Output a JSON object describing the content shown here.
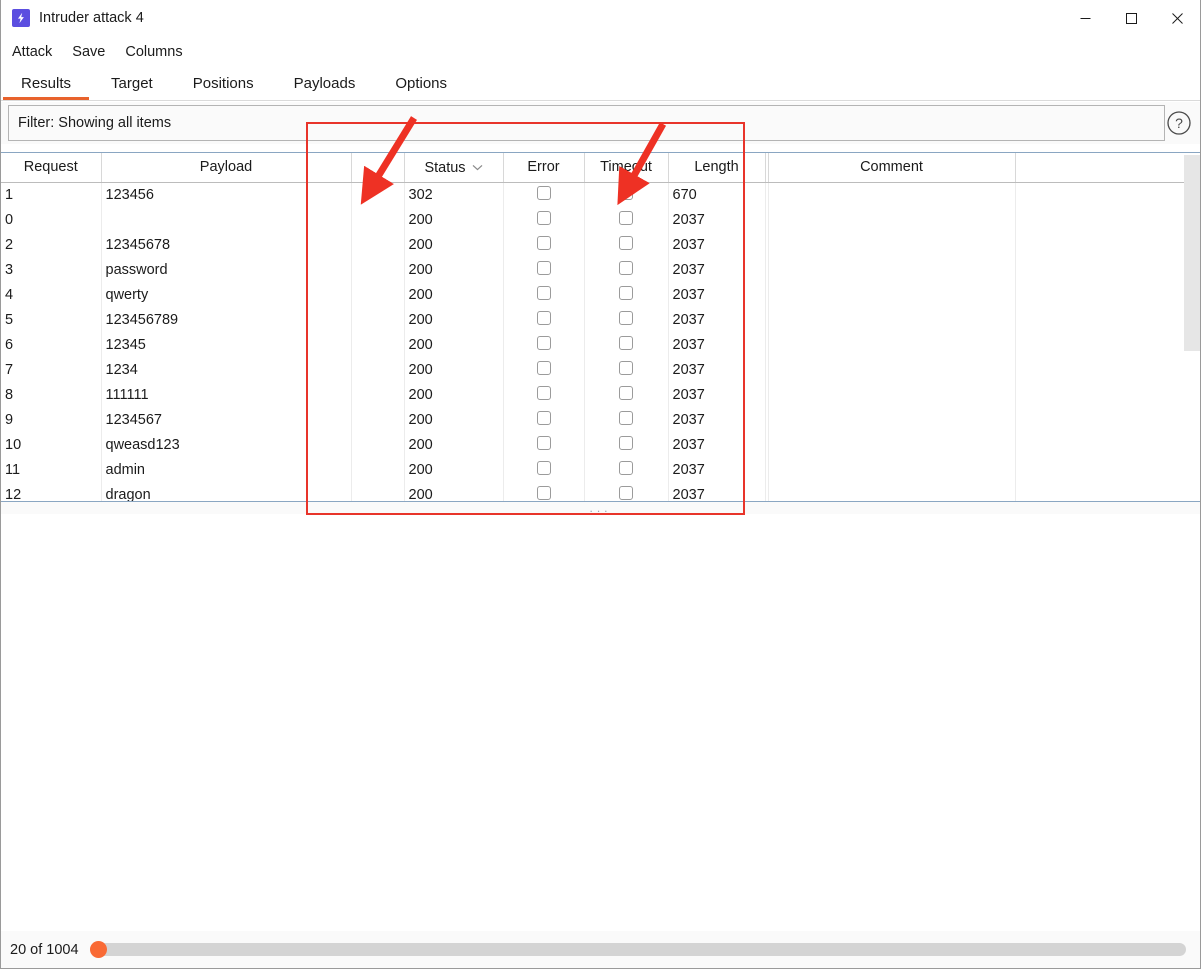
{
  "window": {
    "title": "Intruder attack 4",
    "icon": "lightning-bolt-icon",
    "controls": {
      "minimize": "minimize-icon",
      "maximize": "maximize-icon",
      "close": "close-icon"
    }
  },
  "menubar": {
    "items": [
      {
        "label": "Attack"
      },
      {
        "label": "Save"
      },
      {
        "label": "Columns"
      }
    ]
  },
  "tabs": [
    {
      "label": "Results",
      "active": true
    },
    {
      "label": "Target",
      "active": false
    },
    {
      "label": "Positions",
      "active": false
    },
    {
      "label": "Payloads",
      "active": false
    },
    {
      "label": "Options",
      "active": false
    }
  ],
  "filter": {
    "text": "Filter: Showing all items",
    "help_icon": "question-mark-circle-icon"
  },
  "table": {
    "columns": [
      {
        "key": "request",
        "label": "Request",
        "align": "left"
      },
      {
        "key": "payload",
        "label": "Payload",
        "align": "center"
      },
      {
        "key": "spacer1",
        "label": "",
        "align": "center"
      },
      {
        "key": "status",
        "label": "Status",
        "align": "center",
        "sorted": true,
        "sort_icon": "chevron-down-icon"
      },
      {
        "key": "error",
        "label": "Error",
        "align": "center"
      },
      {
        "key": "timeout",
        "label": "Timeout",
        "align": "center"
      },
      {
        "key": "length",
        "label": "Length",
        "align": "center"
      },
      {
        "key": "spacer2",
        "label": "",
        "align": "center"
      },
      {
        "key": "comment",
        "label": "Comment",
        "align": "center"
      },
      {
        "key": "spacer3",
        "label": "",
        "align": "center"
      }
    ],
    "rows": [
      {
        "request": "1",
        "payload": "123456",
        "status": "302",
        "error": false,
        "timeout": false,
        "length": "670",
        "comment": ""
      },
      {
        "request": "0",
        "payload": "",
        "status": "200",
        "error": false,
        "timeout": false,
        "length": "2037",
        "comment": ""
      },
      {
        "request": "2",
        "payload": "12345678",
        "status": "200",
        "error": false,
        "timeout": false,
        "length": "2037",
        "comment": ""
      },
      {
        "request": "3",
        "payload": "password",
        "status": "200",
        "error": false,
        "timeout": false,
        "length": "2037",
        "comment": ""
      },
      {
        "request": "4",
        "payload": "qwerty",
        "status": "200",
        "error": false,
        "timeout": false,
        "length": "2037",
        "comment": ""
      },
      {
        "request": "5",
        "payload": "123456789",
        "status": "200",
        "error": false,
        "timeout": false,
        "length": "2037",
        "comment": ""
      },
      {
        "request": "6",
        "payload": "12345",
        "status": "200",
        "error": false,
        "timeout": false,
        "length": "2037",
        "comment": ""
      },
      {
        "request": "7",
        "payload": "1234",
        "status": "200",
        "error": false,
        "timeout": false,
        "length": "2037",
        "comment": ""
      },
      {
        "request": "8",
        "payload": "111111",
        "status": "200",
        "error": false,
        "timeout": false,
        "length": "2037",
        "comment": ""
      },
      {
        "request": "9",
        "payload": "1234567",
        "status": "200",
        "error": false,
        "timeout": false,
        "length": "2037",
        "comment": ""
      },
      {
        "request": "10",
        "payload": "qweasd123",
        "status": "200",
        "error": false,
        "timeout": false,
        "length": "2037",
        "comment": ""
      },
      {
        "request": "11",
        "payload": "admin",
        "status": "200",
        "error": false,
        "timeout": false,
        "length": "2037",
        "comment": ""
      },
      {
        "request": "12",
        "payload": "dragon",
        "status": "200",
        "error": false,
        "timeout": false,
        "length": "2037",
        "comment": ""
      }
    ]
  },
  "splitter": {
    "handle": "..."
  },
  "statusbar": {
    "progress_text": "20 of 1004",
    "progress_value": 20,
    "progress_total": 1004
  },
  "annotations": {
    "highlight_color": "#e8342a",
    "rect": {
      "label": "status-and-length-columns-highlight"
    },
    "arrows": [
      {
        "label": "status-column-arrow",
        "target": "Status"
      },
      {
        "label": "length-column-arrow",
        "target": "Length"
      }
    ]
  },
  "colors": {
    "accent": "#e8622c",
    "progress_knob": "#f96a35",
    "icon_background": "#5b4ee0",
    "annotation": "#e8342a"
  }
}
